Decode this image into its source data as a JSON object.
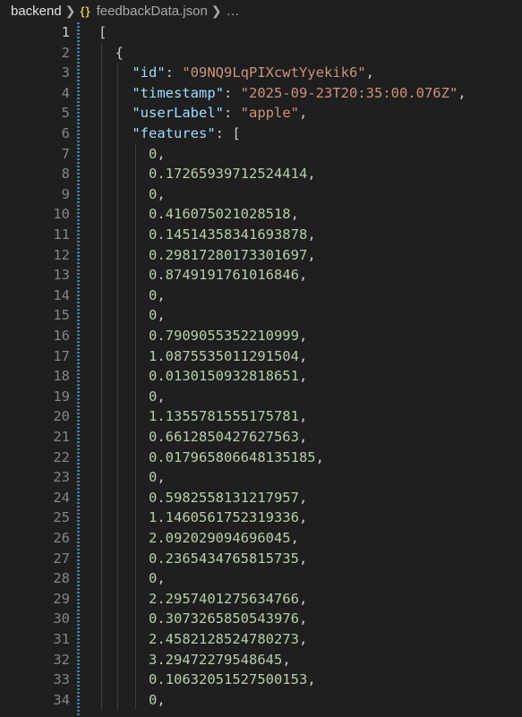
{
  "breadcrumb": {
    "folder": "backend",
    "file_icon": "{}",
    "file": "feedbackData.json",
    "more": "…"
  },
  "editor": {
    "lines": [
      {
        "n": "1",
        "segs": [
          {
            "t": "[",
            "c": "punc"
          }
        ]
      },
      {
        "n": "2",
        "segs": [
          {
            "t": "  {",
            "c": "punc"
          }
        ]
      },
      {
        "n": "3",
        "segs": [
          {
            "t": "    ",
            "c": "punc"
          },
          {
            "t": "\"id\"",
            "c": "key"
          },
          {
            "t": ": ",
            "c": "punc"
          },
          {
            "t": "\"09NQ9LqPIXcwtYyekik6\"",
            "c": "str"
          },
          {
            "t": ",",
            "c": "punc"
          }
        ]
      },
      {
        "n": "4",
        "segs": [
          {
            "t": "    ",
            "c": "punc"
          },
          {
            "t": "\"timestamp\"",
            "c": "key"
          },
          {
            "t": ": ",
            "c": "punc"
          },
          {
            "t": "\"2025-09-23T20:35:00.076Z\"",
            "c": "str"
          },
          {
            "t": ",",
            "c": "punc"
          }
        ]
      },
      {
        "n": "5",
        "segs": [
          {
            "t": "    ",
            "c": "punc"
          },
          {
            "t": "\"userLabel\"",
            "c": "key"
          },
          {
            "t": ": ",
            "c": "punc"
          },
          {
            "t": "\"apple\"",
            "c": "str"
          },
          {
            "t": ",",
            "c": "punc"
          }
        ]
      },
      {
        "n": "6",
        "segs": [
          {
            "t": "    ",
            "c": "punc"
          },
          {
            "t": "\"features\"",
            "c": "key"
          },
          {
            "t": ": [",
            "c": "punc"
          }
        ]
      },
      {
        "n": "7",
        "segs": [
          {
            "t": "      ",
            "c": "punc"
          },
          {
            "t": "0",
            "c": "num"
          },
          {
            "t": ",",
            "c": "punc"
          }
        ]
      },
      {
        "n": "8",
        "segs": [
          {
            "t": "      ",
            "c": "punc"
          },
          {
            "t": "0.17265939712524414",
            "c": "num"
          },
          {
            "t": ",",
            "c": "punc"
          }
        ]
      },
      {
        "n": "9",
        "segs": [
          {
            "t": "      ",
            "c": "punc"
          },
          {
            "t": "0",
            "c": "num"
          },
          {
            "t": ",",
            "c": "punc"
          }
        ]
      },
      {
        "n": "10",
        "segs": [
          {
            "t": "      ",
            "c": "punc"
          },
          {
            "t": "0.416075021028518",
            "c": "num"
          },
          {
            "t": ",",
            "c": "punc"
          }
        ]
      },
      {
        "n": "11",
        "segs": [
          {
            "t": "      ",
            "c": "punc"
          },
          {
            "t": "0.14514358341693878",
            "c": "num"
          },
          {
            "t": ",",
            "c": "punc"
          }
        ]
      },
      {
        "n": "12",
        "segs": [
          {
            "t": "      ",
            "c": "punc"
          },
          {
            "t": "0.29817280173301697",
            "c": "num"
          },
          {
            "t": ",",
            "c": "punc"
          }
        ]
      },
      {
        "n": "13",
        "segs": [
          {
            "t": "      ",
            "c": "punc"
          },
          {
            "t": "0.8749191761016846",
            "c": "num"
          },
          {
            "t": ",",
            "c": "punc"
          }
        ]
      },
      {
        "n": "14",
        "segs": [
          {
            "t": "      ",
            "c": "punc"
          },
          {
            "t": "0",
            "c": "num"
          },
          {
            "t": ",",
            "c": "punc"
          }
        ]
      },
      {
        "n": "15",
        "segs": [
          {
            "t": "      ",
            "c": "punc"
          },
          {
            "t": "0",
            "c": "num"
          },
          {
            "t": ",",
            "c": "punc"
          }
        ]
      },
      {
        "n": "16",
        "segs": [
          {
            "t": "      ",
            "c": "punc"
          },
          {
            "t": "0.7909055352210999",
            "c": "num"
          },
          {
            "t": ",",
            "c": "punc"
          }
        ]
      },
      {
        "n": "17",
        "segs": [
          {
            "t": "      ",
            "c": "punc"
          },
          {
            "t": "1.0875535011291504",
            "c": "num"
          },
          {
            "t": ",",
            "c": "punc"
          }
        ]
      },
      {
        "n": "18",
        "segs": [
          {
            "t": "      ",
            "c": "punc"
          },
          {
            "t": "0.0130150932818651",
            "c": "num"
          },
          {
            "t": ",",
            "c": "punc"
          }
        ]
      },
      {
        "n": "19",
        "segs": [
          {
            "t": "      ",
            "c": "punc"
          },
          {
            "t": "0",
            "c": "num"
          },
          {
            "t": ",",
            "c": "punc"
          }
        ]
      },
      {
        "n": "20",
        "segs": [
          {
            "t": "      ",
            "c": "punc"
          },
          {
            "t": "1.1355781555175781",
            "c": "num"
          },
          {
            "t": ",",
            "c": "punc"
          }
        ]
      },
      {
        "n": "21",
        "segs": [
          {
            "t": "      ",
            "c": "punc"
          },
          {
            "t": "0.6612850427627563",
            "c": "num"
          },
          {
            "t": ",",
            "c": "punc"
          }
        ]
      },
      {
        "n": "22",
        "segs": [
          {
            "t": "      ",
            "c": "punc"
          },
          {
            "t": "0.017965806648135185",
            "c": "num"
          },
          {
            "t": ",",
            "c": "punc"
          }
        ]
      },
      {
        "n": "23",
        "segs": [
          {
            "t": "      ",
            "c": "punc"
          },
          {
            "t": "0",
            "c": "num"
          },
          {
            "t": ",",
            "c": "punc"
          }
        ]
      },
      {
        "n": "24",
        "segs": [
          {
            "t": "      ",
            "c": "punc"
          },
          {
            "t": "0.5982558131217957",
            "c": "num"
          },
          {
            "t": ",",
            "c": "punc"
          }
        ]
      },
      {
        "n": "25",
        "segs": [
          {
            "t": "      ",
            "c": "punc"
          },
          {
            "t": "1.1460561752319336",
            "c": "num"
          },
          {
            "t": ",",
            "c": "punc"
          }
        ]
      },
      {
        "n": "26",
        "segs": [
          {
            "t": "      ",
            "c": "punc"
          },
          {
            "t": "2.092029094696045",
            "c": "num"
          },
          {
            "t": ",",
            "c": "punc"
          }
        ]
      },
      {
        "n": "27",
        "segs": [
          {
            "t": "      ",
            "c": "punc"
          },
          {
            "t": "0.2365434765815735",
            "c": "num"
          },
          {
            "t": ",",
            "c": "punc"
          }
        ]
      },
      {
        "n": "28",
        "segs": [
          {
            "t": "      ",
            "c": "punc"
          },
          {
            "t": "0",
            "c": "num"
          },
          {
            "t": ",",
            "c": "punc"
          }
        ]
      },
      {
        "n": "29",
        "segs": [
          {
            "t": "      ",
            "c": "punc"
          },
          {
            "t": "2.2957401275634766",
            "c": "num"
          },
          {
            "t": ",",
            "c": "punc"
          }
        ]
      },
      {
        "n": "30",
        "segs": [
          {
            "t": "      ",
            "c": "punc"
          },
          {
            "t": "0.3073265850543976",
            "c": "num"
          },
          {
            "t": ",",
            "c": "punc"
          }
        ]
      },
      {
        "n": "31",
        "segs": [
          {
            "t": "      ",
            "c": "punc"
          },
          {
            "t": "2.4582128524780273",
            "c": "num"
          },
          {
            "t": ",",
            "c": "punc"
          }
        ]
      },
      {
        "n": "32",
        "segs": [
          {
            "t": "      ",
            "c": "punc"
          },
          {
            "t": "3.29472279548645",
            "c": "num"
          },
          {
            "t": ",",
            "c": "punc"
          }
        ]
      },
      {
        "n": "33",
        "segs": [
          {
            "t": "      ",
            "c": "punc"
          },
          {
            "t": "0.10632051527500153",
            "c": "num"
          },
          {
            "t": ",",
            "c": "punc"
          }
        ]
      },
      {
        "n": "34",
        "segs": [
          {
            "t": "      ",
            "c": "punc"
          },
          {
            "t": "0",
            "c": "num"
          },
          {
            "t": ",",
            "c": "punc"
          }
        ]
      }
    ]
  },
  "colors": {
    "background": "#1f1f1f",
    "key": "#9cdcfe",
    "string": "#ce9178",
    "number": "#b5cea8",
    "underline": "#c724c9"
  }
}
